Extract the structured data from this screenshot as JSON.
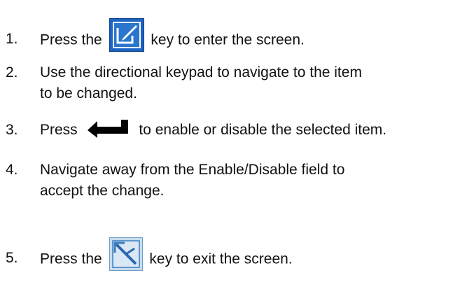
{
  "steps": [
    {
      "number": "1.",
      "before": "Press the",
      "icon": "edit-screen-key-icon",
      "after": "key to enter the screen."
    },
    {
      "number": "2.",
      "text_line1": "Use the directional keypad to navigate to the item",
      "text_line2": "to be changed."
    },
    {
      "number": "3.",
      "before": "Press",
      "icon": "enter-key-icon",
      "after": "to enable or disable the selected item."
    },
    {
      "number": "4.",
      "text_line1": "Navigate away from the Enable/Disable field to",
      "text_line2": "accept the change."
    },
    {
      "number": "5.",
      "before": "Press the",
      "icon": "exit-screen-key-icon",
      "after": "key to exit the screen."
    }
  ],
  "colors": {
    "edit_key_blue": "#1c63c4",
    "exit_key_light": "#c7dcec",
    "exit_key_blue": "#3b7cc1",
    "enter_key_black": "#000000",
    "text": "#111111"
  }
}
